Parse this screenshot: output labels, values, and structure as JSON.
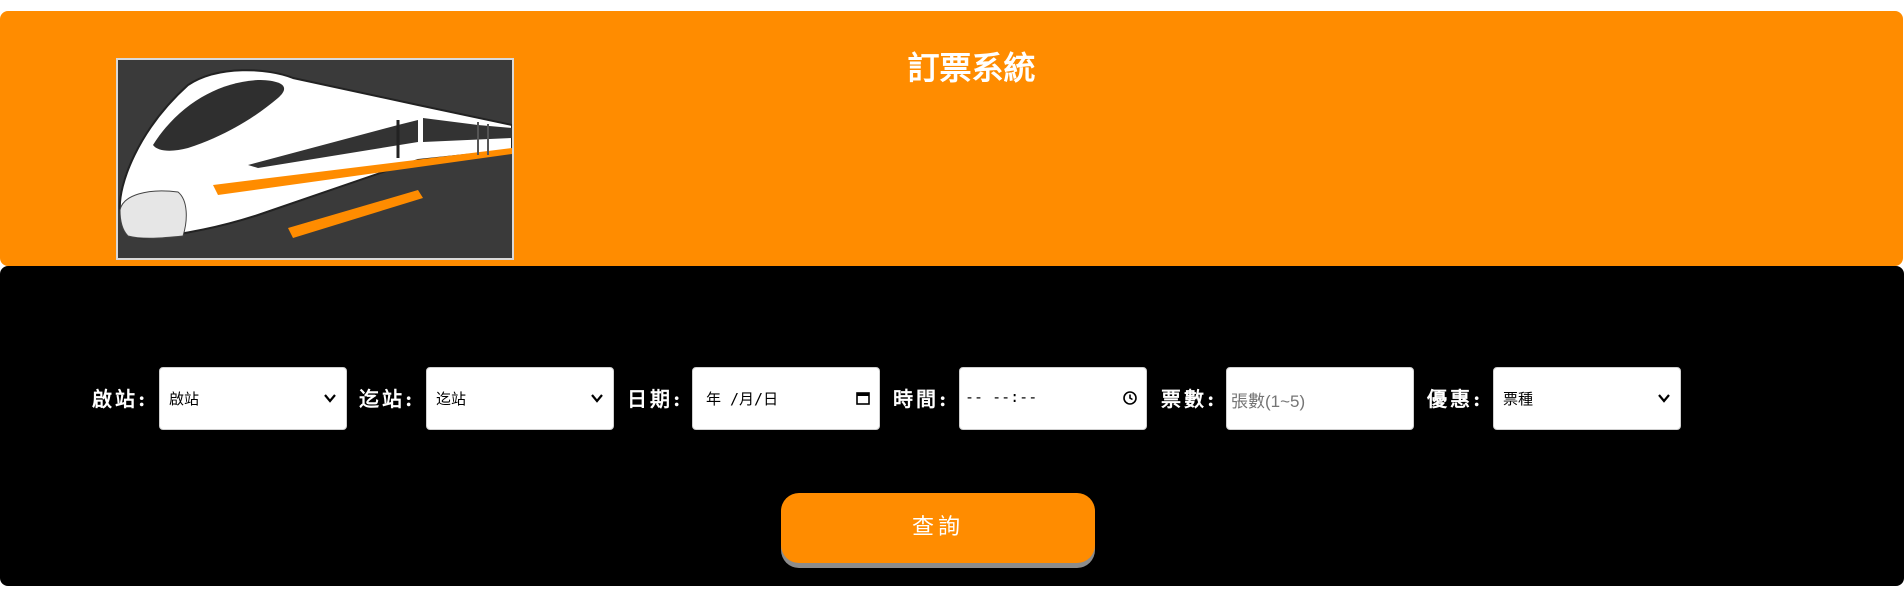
{
  "header": {
    "title": "訂票系統",
    "logo": "high-speed-train-illustration"
  },
  "colors": {
    "accent": "#ff8c00",
    "panel": "#000000",
    "text": "#ffffff"
  },
  "form": {
    "departure": {
      "label": "啟站:",
      "value": "啟站",
      "icon": "chevron-down-icon"
    },
    "arrival": {
      "label": "迄站:",
      "value": "迄站",
      "icon": "chevron-down-icon"
    },
    "date": {
      "label": "日期:",
      "value": "年 /月/日",
      "icon": "calendar-icon"
    },
    "time": {
      "label": "時間:",
      "value": "-- --:--",
      "icon": "clock-icon"
    },
    "tickets": {
      "label": "票數:",
      "placeholder": "張數(1~5)"
    },
    "discount": {
      "label": "優惠:",
      "value": "票種",
      "icon": "chevron-down-icon"
    },
    "search_label": "查詢"
  }
}
